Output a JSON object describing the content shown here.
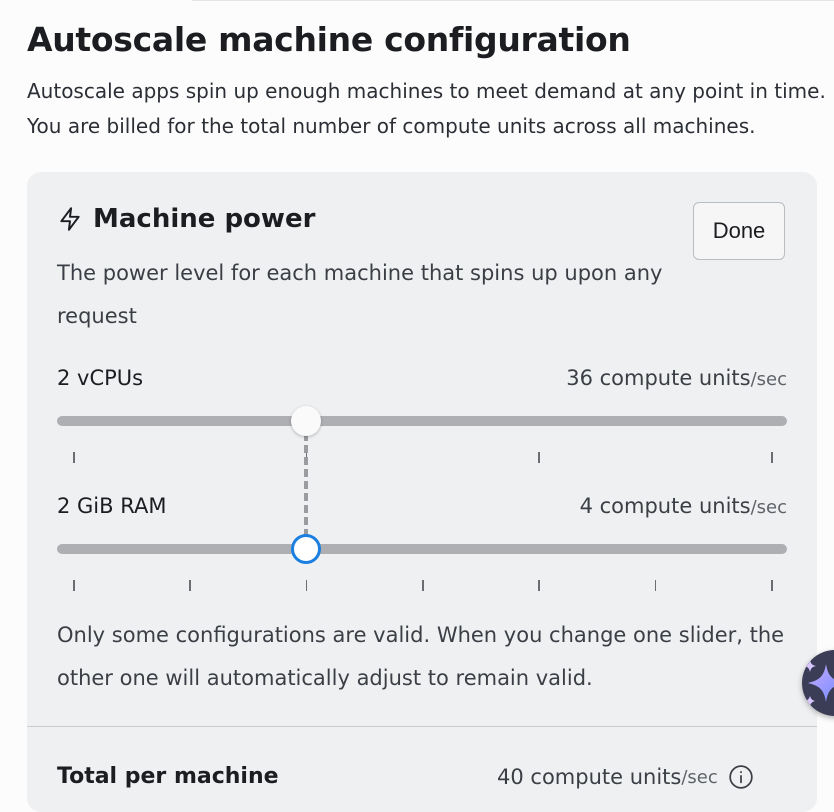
{
  "header": {
    "title": "Autoscale machine configuration",
    "subtitle": "Autoscale apps spin up enough machines to meet demand at any point in time. You are billed for the total number of compute units across all machines."
  },
  "machine_power": {
    "title": "Machine power",
    "done_label": "Done",
    "description": "The power level for each machine that spins up upon any request",
    "cpu": {
      "label": "2 vCPUs",
      "value": "36 compute units",
      "unit": "/sec",
      "ticks": 4,
      "position": 0.3333
    },
    "ram": {
      "label": "2 GiB RAM",
      "value": "4 compute units",
      "unit": "/sec",
      "ticks": 7,
      "position": 0.3333
    },
    "note": "Only some configurations are valid. When you change one slider, the other one will automatically adjust to remain valid."
  },
  "total": {
    "label": "Total per machine",
    "value": "40 compute units",
    "unit": "/sec"
  },
  "colors": {
    "accent": "#1a7fe0",
    "panel_bg": "#eff0f2",
    "track": "#adafb3"
  }
}
